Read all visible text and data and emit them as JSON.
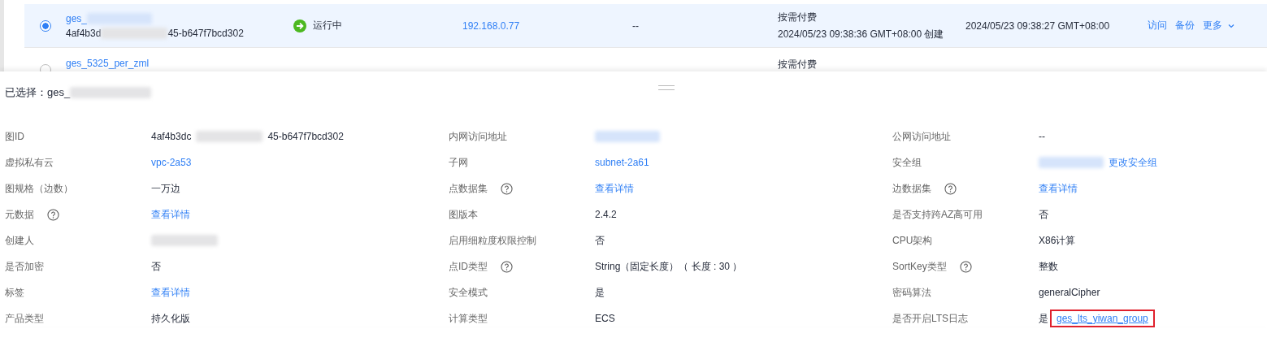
{
  "instances": [
    {
      "selected": true,
      "name_parts": [
        {
          "kind": "text",
          "text": "ges_"
        },
        {
          "kind": "redacted"
        }
      ],
      "id_parts": [
        {
          "kind": "text",
          "text": "4af4b3d"
        },
        {
          "kind": "redacted"
        },
        {
          "kind": "text",
          "text": "45-b647f7bcd302"
        }
      ],
      "status": "运行中",
      "ip": "192.168.0.77",
      "public_ip": "--",
      "billing": "按需付费",
      "created": "2024/05/23 09:38:36 GMT+08:00 创建",
      "updated": "2024/05/23 09:38:27 GMT+08:00",
      "actions": [
        "访问",
        "备份",
        "更多"
      ]
    },
    {
      "selected": false,
      "name_parts": [
        {
          "kind": "text",
          "text": "ges_5325_per_zml"
        }
      ],
      "billing": "按需付费"
    }
  ],
  "detail": {
    "selected_label": "已选择：ges_",
    "fields": [
      {
        "label": "图ID",
        "kind": "plain",
        "value": [
          {
            "kind": "text",
            "text": "4af4b3dc"
          },
          {
            "kind": "redacted"
          },
          {
            "kind": "text",
            "text": "45-b647f7bcd302"
          }
        ]
      },
      {
        "label": "内网访问地址",
        "kind": "plain",
        "value": [
          {
            "kind": "redacted-link"
          }
        ]
      },
      {
        "label": "公网访问地址",
        "kind": "plain",
        "value": [
          {
            "kind": "text",
            "text": "--"
          }
        ]
      },
      {
        "label": "虚拟私有云",
        "kind": "plain",
        "value": [
          {
            "kind": "link",
            "text": "vpc-2a53"
          }
        ]
      },
      {
        "label": "子网",
        "kind": "plain",
        "value": [
          {
            "kind": "link",
            "text": "subnet-2a61"
          }
        ]
      },
      {
        "label": "安全组",
        "kind": "plain",
        "value": [
          {
            "kind": "redacted-link"
          },
          {
            "kind": "link",
            "text": "更改安全组"
          }
        ]
      },
      {
        "label": "图规格（边数）",
        "kind": "plain",
        "value": [
          {
            "kind": "text",
            "text": "一万边"
          }
        ]
      },
      {
        "label": "点数据集",
        "kind": "help",
        "value": [
          {
            "kind": "link",
            "text": "查看详情"
          }
        ]
      },
      {
        "label": "边数据集",
        "kind": "help",
        "value": [
          {
            "kind": "link",
            "text": "查看详情"
          }
        ]
      },
      {
        "label": "元数据",
        "kind": "help",
        "value": [
          {
            "kind": "link",
            "text": "查看详情"
          }
        ]
      },
      {
        "label": "图版本",
        "kind": "plain",
        "value": [
          {
            "kind": "text",
            "text": "2.4.2"
          }
        ]
      },
      {
        "label": "是否支持跨AZ高可用",
        "kind": "plain",
        "value": [
          {
            "kind": "text",
            "text": "否"
          }
        ]
      },
      {
        "label": "创建人",
        "kind": "plain",
        "value": [
          {
            "kind": "redacted"
          }
        ]
      },
      {
        "label": "启用细粒度权限控制",
        "kind": "plain",
        "value": [
          {
            "kind": "text",
            "text": "否"
          }
        ]
      },
      {
        "label": "CPU架构",
        "kind": "plain",
        "value": [
          {
            "kind": "text",
            "text": "X86计算"
          }
        ]
      },
      {
        "label": "是否加密",
        "kind": "plain",
        "value": [
          {
            "kind": "text",
            "text": "否"
          }
        ]
      },
      {
        "label": "点ID类型",
        "kind": "help",
        "value": [
          {
            "kind": "text",
            "text": "String（固定长度）（ 长度 : 30 ）"
          }
        ]
      },
      {
        "label": "SortKey类型",
        "kind": "help",
        "value": [
          {
            "kind": "text",
            "text": "整数"
          }
        ]
      },
      {
        "label": "标签",
        "kind": "plain",
        "value": [
          {
            "kind": "link",
            "text": "查看详情"
          }
        ]
      },
      {
        "label": "安全模式",
        "kind": "plain",
        "value": [
          {
            "kind": "text",
            "text": "是"
          }
        ]
      },
      {
        "label": "密码算法",
        "kind": "plain",
        "value": [
          {
            "kind": "text",
            "text": "generalCipher"
          }
        ]
      },
      {
        "label": "产品类型",
        "kind": "plain",
        "value": [
          {
            "kind": "text",
            "text": "持久化版"
          }
        ]
      },
      {
        "label": "计算类型",
        "kind": "plain",
        "value": [
          {
            "kind": "text",
            "text": "ECS"
          }
        ]
      },
      {
        "label": "是否开启LTS日志",
        "kind": "plain",
        "value": [
          {
            "kind": "text",
            "text": "是"
          },
          {
            "kind": "highlighted-link",
            "text": "ges_lts_yiwan_group"
          }
        ]
      }
    ]
  }
}
